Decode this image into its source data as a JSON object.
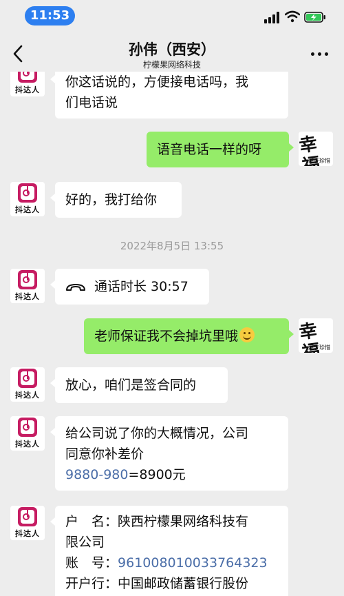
{
  "status": {
    "time": "11:53"
  },
  "header": {
    "title": "孙伟（西安）",
    "subtitle": "柠檬果网络科技"
  },
  "avatars": {
    "app_caption": "抖达人",
    "me_logo_text": "幸福",
    "me_small_text": "源于珍惜"
  },
  "messages": {
    "m1_line1": "你这话说的，方便接电话吗，我",
    "m1_line2": "们电话说",
    "m2": "语音电话一样的呀",
    "m3": "好的，我打给你",
    "timestamp": "2022年8月5日 13:55",
    "m4_label": "通话时长 30:57",
    "m5": "老师保证我不会掉坑里哦",
    "m6": "放心，咱们是签合同的",
    "m7_line1": "给公司说了你的大概情况，公司",
    "m7_line2": "同意你补差价",
    "m7_link": "9880-980",
    "m7_rest": "=8900元",
    "m8_line1": "户　名：陕西柠檬果网络科技有",
    "m8_line2": "限公司",
    "m8_account_label": "账　号：",
    "m8_account": "961008010033764323",
    "m8_bank": "开户行：中国邮政储蓄银行股份"
  },
  "icons": {
    "back": "chevron-left-icon",
    "more": "more-dots-icon",
    "call": "phone-handset-icon",
    "emoji": "smile-emoji-icon"
  },
  "colors": {
    "accent_green": "#95ec69",
    "link_blue": "#4b6ea8",
    "app_brand": "#c61c62"
  }
}
